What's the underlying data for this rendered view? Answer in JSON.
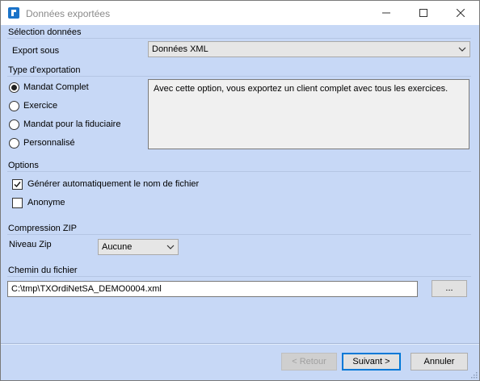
{
  "window": {
    "title": "Données exportées"
  },
  "selection": {
    "section": "Sélection données",
    "export_label": "Export sous",
    "export_value": "Données XML"
  },
  "type": {
    "section": "Type d'exportation",
    "options": [
      "Mandat Complet",
      "Exercice",
      "Mandat pour la fiduciaire",
      "Personnalisé"
    ],
    "selected": "Mandat Complet",
    "description": "Avec cette option, vous exportez un client complet avec tous les exercices."
  },
  "options": {
    "section": "Options",
    "auto_name": "Générer automatiquement le nom de fichier",
    "auto_name_checked": true,
    "anonymous": "Anonyme",
    "anonymous_checked": false
  },
  "zip": {
    "section": "Compression ZIP",
    "level_label": "Niveau Zip",
    "level_value": "Aucune"
  },
  "path": {
    "section": "Chemin du fichier",
    "value": "C:\\tmp\\TXOrdiNetSA_DEMO0004.xml",
    "browse": "..."
  },
  "footer": {
    "back": "< Retour",
    "next": "Suivant >",
    "cancel": "Annuler"
  }
}
